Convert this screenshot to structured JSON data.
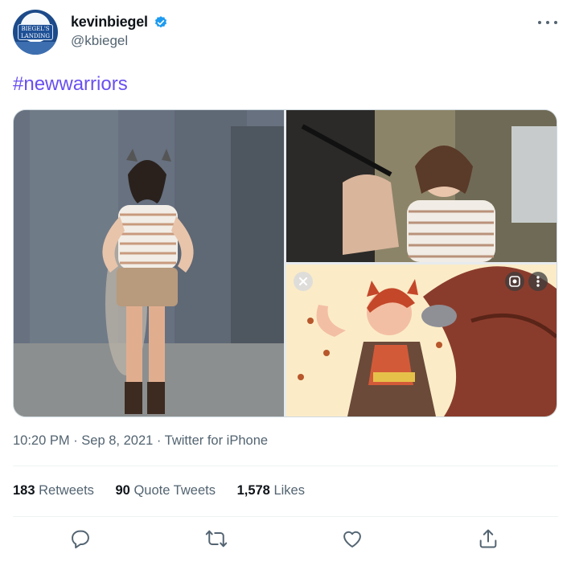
{
  "author": {
    "name": "kevinbiegel",
    "handle": "@kbiegel",
    "avatar_text": "BIEGEL'S LANDING",
    "verified_icon": "verified-badge-icon",
    "verified_color": "#1d9bf0"
  },
  "tweet": {
    "text": "#newwarriors",
    "hashtag_color": "#6a4ff0"
  },
  "media": {
    "images": [
      {
        "icon": "photo-cosplay-full-body"
      },
      {
        "icon": "photo-cosplay-closeup"
      },
      {
        "icon": "comic-squirrel-girl-art"
      }
    ],
    "overlay_buttons": [
      "close-icon",
      "lens-search-icon",
      "more-vertical-icon"
    ]
  },
  "meta": {
    "time": "10:20 PM",
    "separator": " · ",
    "date": "Sep 8, 2021",
    "source": "Twitter for iPhone"
  },
  "stats": {
    "retweets_count": "183",
    "retweets_label": "Retweets",
    "quotes_count": "90",
    "quotes_label": "Quote Tweets",
    "likes_count": "1,578",
    "likes_label": "Likes"
  },
  "actions": [
    "reply-icon",
    "retweet-icon",
    "like-icon",
    "share-icon"
  ],
  "colors": {
    "secondary_text": "#536471",
    "primary_text": "#0f1419",
    "divider": "#eff3f4"
  }
}
